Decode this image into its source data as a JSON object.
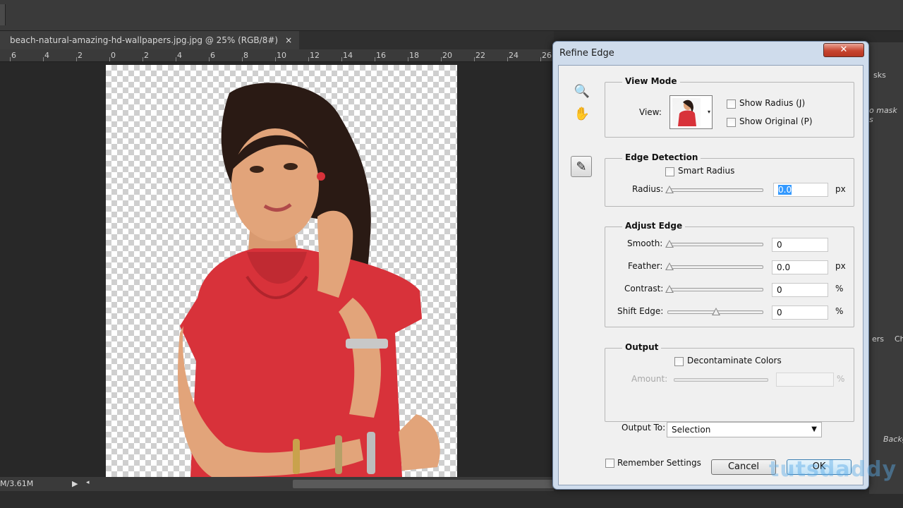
{
  "document": {
    "tab_title": "beach-natural-amazing-hd-wallpapers.jpg.jpg @ 25% (RGB/8#)",
    "close_glyph": "×",
    "ruler_labels": [
      "6",
      "4",
      "2",
      "0",
      "2",
      "4",
      "6",
      "8",
      "10",
      "12",
      "14",
      "16",
      "18",
      "20",
      "22",
      "24",
      "26"
    ],
    "status_text": "M/3.61M",
    "status_play": "▶",
    "status_arrow": "◂"
  },
  "right_panel": {
    "text1": "sks",
    "text2": "o mask s",
    "text3": "ers",
    "text4": "Ch",
    "text5": "Backg"
  },
  "dialog": {
    "title": "Refine Edge",
    "close_glyph": "✕",
    "tools": {
      "zoom": "🔍",
      "hand": "✋",
      "refine": "✎"
    },
    "view_mode": {
      "title": "View Mode",
      "view_label": "View:",
      "view_dropdown_arrow": "▾",
      "show_radius": "Show Radius (J)",
      "show_original": "Show Original (P)"
    },
    "edge_detection": {
      "title": "Edge Detection",
      "smart_radius": "Smart Radius",
      "radius_label": "Radius:",
      "radius_value": "0.0",
      "radius_unit": "px",
      "radius_level": 0
    },
    "adjust_edge": {
      "title": "Adjust Edge",
      "rows": [
        {
          "label": "Smooth:",
          "value": "0",
          "unit": "",
          "level": 0
        },
        {
          "label": "Feather:",
          "value": "0.0",
          "unit": "px",
          "level": 0
        },
        {
          "label": "Contrast:",
          "value": "0",
          "unit": "%",
          "level": 0
        },
        {
          "label": "Shift Edge:",
          "value": "0",
          "unit": "%",
          "level": 0.5
        }
      ]
    },
    "output": {
      "title": "Output",
      "decontaminate": "Decontaminate Colors",
      "amount_label": "Amount:",
      "amount_unit": "%",
      "output_to_label": "Output To:",
      "output_to_value": "Selection",
      "dropdown_arrow": "▼"
    },
    "remember_settings": "Remember Settings",
    "cancel": "Cancel",
    "ok": "OK"
  },
  "watermark": "tutsdaddy",
  "colors": {
    "dress": "#d8323a",
    "skin": "#e2a47a",
    "hair": "#2a1a14",
    "ok_border": "#3c7fb1"
  }
}
